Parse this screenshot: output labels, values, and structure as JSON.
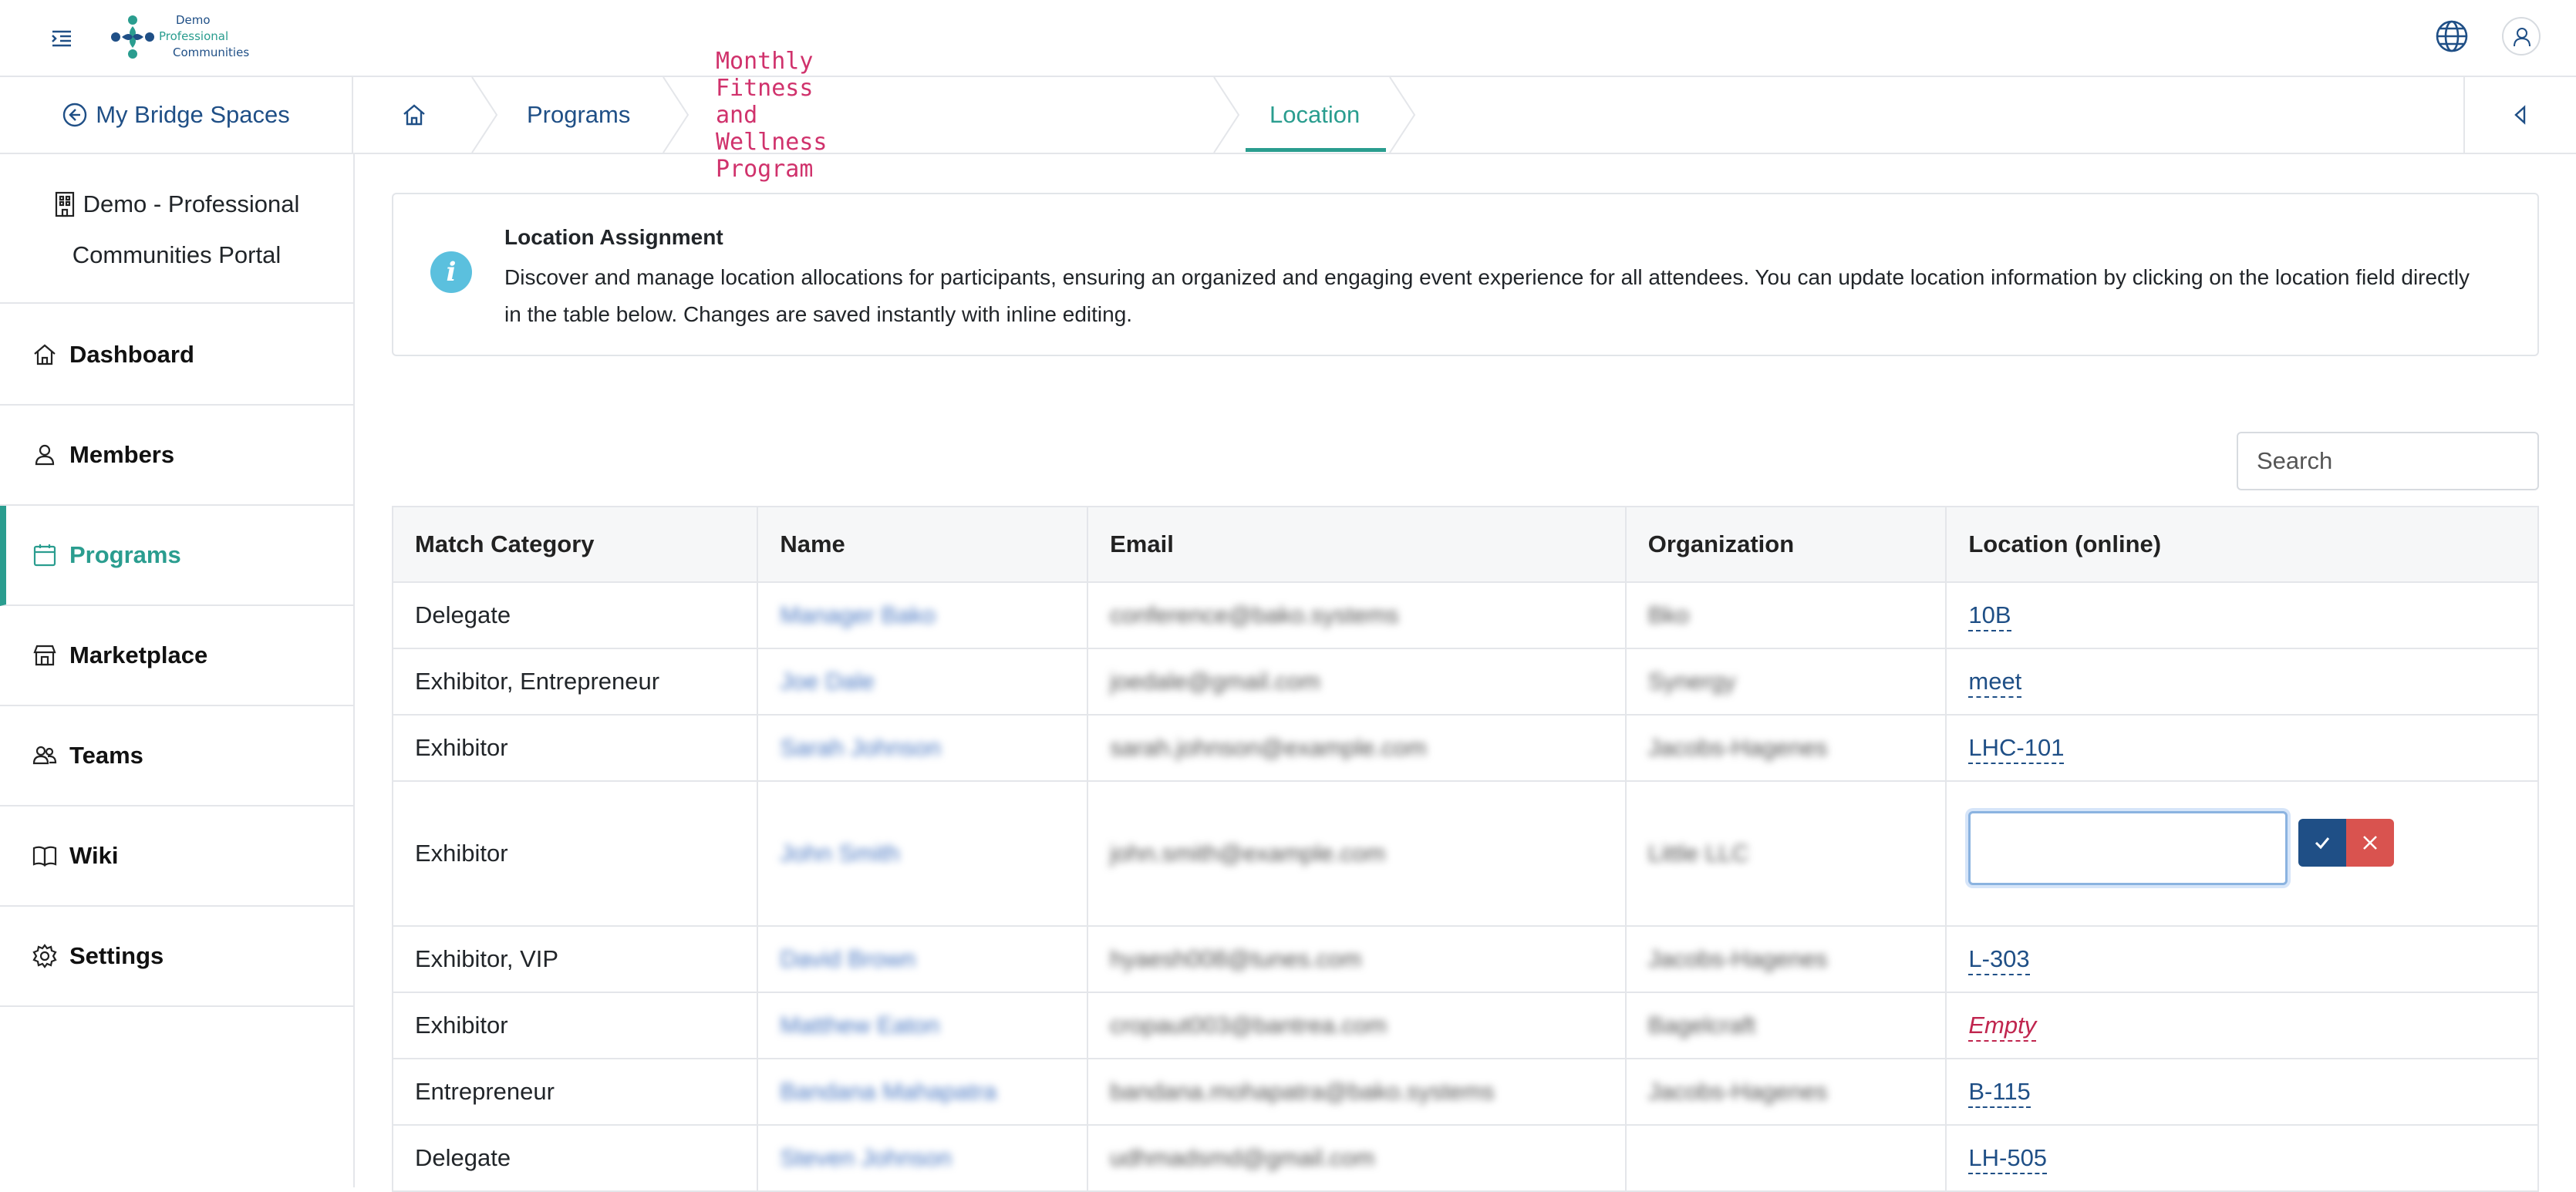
{
  "header": {
    "logo": {
      "line1": "Demo",
      "line2": "Professional",
      "line3": "Communities"
    },
    "icons": {
      "menu": "menu-indent-icon",
      "globe": "globe-icon",
      "user": "user-icon"
    }
  },
  "subnav": {
    "back_label": "My Bridge Spaces",
    "breadcrumbs": [
      {
        "label": "",
        "icon": "home-icon"
      },
      {
        "label": "Programs"
      },
      {
        "label": "Monthly Fitness and Wellness Program"
      },
      {
        "label": "Location"
      }
    ]
  },
  "sidebar": {
    "org_name_line1": "Demo - Professional",
    "org_name_line2": "Communities Portal",
    "items": [
      {
        "label": "Dashboard",
        "icon": "home-icon",
        "active": false
      },
      {
        "label": "Members",
        "icon": "person-icon",
        "active": false
      },
      {
        "label": "Programs",
        "icon": "calendar-icon",
        "active": true
      },
      {
        "label": "Marketplace",
        "icon": "store-icon",
        "active": false
      },
      {
        "label": "Teams",
        "icon": "people-icon",
        "active": false
      },
      {
        "label": "Wiki",
        "icon": "book-icon",
        "active": false
      },
      {
        "label": "Settings",
        "icon": "gear-icon",
        "active": false
      }
    ]
  },
  "info": {
    "title": "Location Assignment",
    "text": "Discover and manage location allocations for participants, ensuring an organized and engaging event experience for all attendees. You can update location information by clicking on the location field directly in the table below. Changes are saved instantly with inline editing."
  },
  "search": {
    "placeholder": "Search",
    "value": ""
  },
  "table": {
    "headers": [
      "Match Category",
      "Name",
      "Email",
      "Organization",
      "Location (online)"
    ],
    "rows": [
      {
        "category": "Delegate",
        "name": "Manager Bako",
        "email": "conference@bako.systems",
        "org": "Bko",
        "location": "10B"
      },
      {
        "category": "Exhibitor, Entrepreneur",
        "name": "Joe Dale",
        "email": "joedale@gmail.com",
        "org": "Synergy",
        "location": "meet"
      },
      {
        "category": "Exhibitor",
        "name": "Sarah Johnson",
        "email": "sarah.johnson@example.com",
        "org": "Jacobs-Hagenes",
        "location": "LHC-101"
      },
      {
        "category": "Exhibitor",
        "name": "John Smith",
        "email": "john.smith@example.com",
        "org": "Little LLC",
        "location": "",
        "editing": true
      },
      {
        "category": "Exhibitor, VIP",
        "name": "David Brown",
        "email": "hyaesh008@tunes.com",
        "org": "Jacobs-Hagenes",
        "location": "L-303"
      },
      {
        "category": "Exhibitor",
        "name": "Matthew Eaton",
        "email": "cropaut003@bantrea.com",
        "org": "Bagelcraft",
        "location": "Empty",
        "empty": true
      },
      {
        "category": "Entrepreneur",
        "name": "Bandana Mahapatra",
        "email": "bandana.mohapatra@bako.systems",
        "org": "Jacobs-Hagenes",
        "location": "B-115"
      },
      {
        "category": "Delegate",
        "name": "Steven Johnson",
        "email": "udhmadsmd@gmail.com",
        "org": "",
        "location": "LH-505"
      }
    ]
  },
  "colors": {
    "brand_blue": "#1f4f86",
    "accent_teal": "#2a9d8f",
    "crumb_pink": "#d0326c",
    "empty_red": "#c0254e",
    "cancel_red": "#d9534f",
    "info_blue": "#5bc0de"
  }
}
